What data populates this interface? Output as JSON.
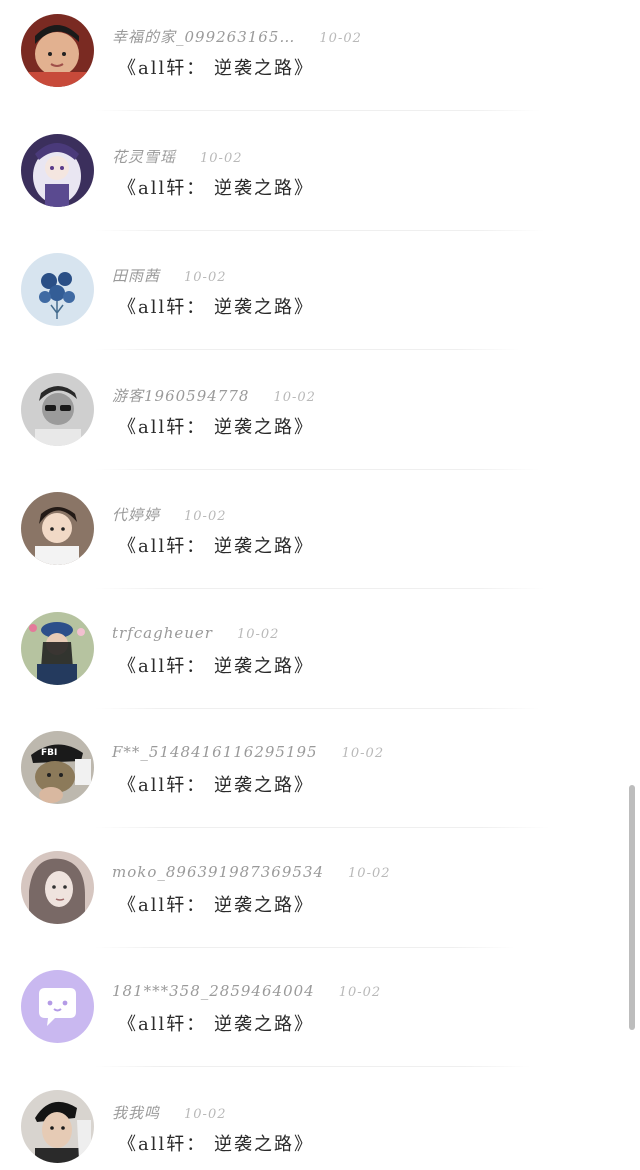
{
  "comments": [
    {
      "name": "幸福的家_099263165…",
      "date": "10-02",
      "text": "《all轩： 逆袭之路》",
      "avatar_icon": "boy-photo-avatar-icon",
      "avatar_color": "#c98a6a"
    },
    {
      "name": "花灵雪瑶",
      "date": "10-02",
      "text": "《all轩： 逆袭之路》",
      "avatar_icon": "anime-girl-avatar-icon",
      "avatar_color": "#5b4a7a"
    },
    {
      "name": "田雨茜",
      "date": "10-02",
      "text": "《all轩： 逆袭之路》",
      "avatar_icon": "blue-roses-avatar-icon",
      "avatar_color": "#a9c4de"
    },
    {
      "name": "游客1960594778",
      "date": "10-02",
      "text": "《all轩： 逆袭之路》",
      "avatar_icon": "sunglasses-man-avatar-icon",
      "avatar_color": "#7d7d7d"
    },
    {
      "name": "代婷婷",
      "date": "10-02",
      "text": "《all轩： 逆袭之路》",
      "avatar_icon": "young-man-avatar-icon",
      "avatar_color": "#d6c3b2"
    },
    {
      "name": "trfcagheuer",
      "date": "10-02",
      "text": "《all轩： 逆袭之路》",
      "avatar_icon": "beret-girl-avatar-icon",
      "avatar_color": "#2f4a7a"
    },
    {
      "name": "F**_5148416116295195",
      "date": "10-02",
      "text": "《all轩： 逆袭之路》",
      "avatar_icon": "fbi-cat-avatar-icon",
      "avatar_color": "#8a7a60"
    },
    {
      "name": "moko_896391987369534",
      "date": "10-02",
      "text": "《all轩： 逆袭之路》",
      "avatar_icon": "sketch-girl-avatar-icon",
      "avatar_color": "#b89a9a"
    },
    {
      "name": "181***358_2859464004",
      "date": "10-02",
      "text": "《all轩： 逆袭之路》",
      "avatar_icon": "chat-bubble-avatar-icon",
      "avatar_color": "#c9b8f0"
    },
    {
      "name": "我我鸣",
      "date": "10-02",
      "text": "《all轩： 逆袭之路》",
      "avatar_icon": "man-portrait-avatar-icon",
      "avatar_color": "#3a3a3a"
    }
  ]
}
